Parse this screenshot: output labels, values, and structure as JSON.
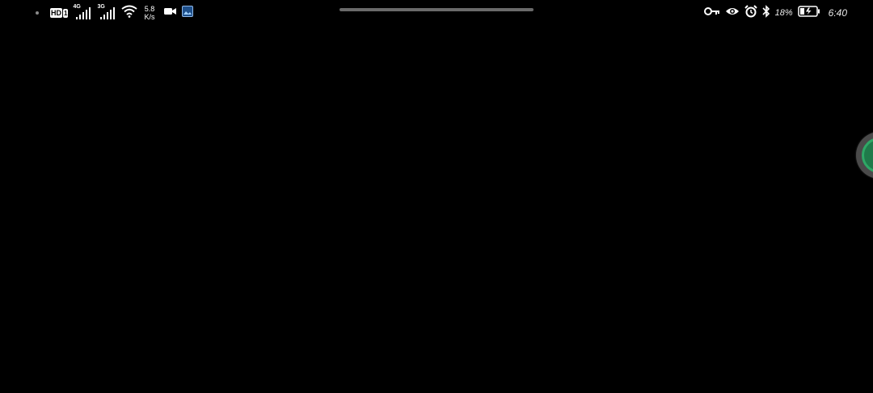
{
  "status_bar": {
    "left": {
      "hd_label": "HD",
      "sim_label": "1",
      "sim1_network": "4G",
      "sim2_network": "3G",
      "data_speed_value": "5.8",
      "data_speed_unit": "K/s",
      "icons": [
        "notification-dot-icon",
        "hd-volte-icon",
        "signal-icon",
        "signal-icon",
        "wifi-icon",
        "video-camera-icon",
        "gallery-notification-icon"
      ]
    },
    "right": {
      "battery_percent": "18%",
      "time": "6:40",
      "icons": [
        "vpn-key-icon",
        "eye-comfort-icon",
        "alarm-icon",
        "bluetooth-icon",
        "battery-charging-icon"
      ]
    }
  },
  "colors": {
    "background": "#000000",
    "status_text": "#ffffff",
    "gesture_pill": "#6a6a6a",
    "bubble_ring": "#4a4a4a",
    "bubble_accent": "#2ea866"
  }
}
